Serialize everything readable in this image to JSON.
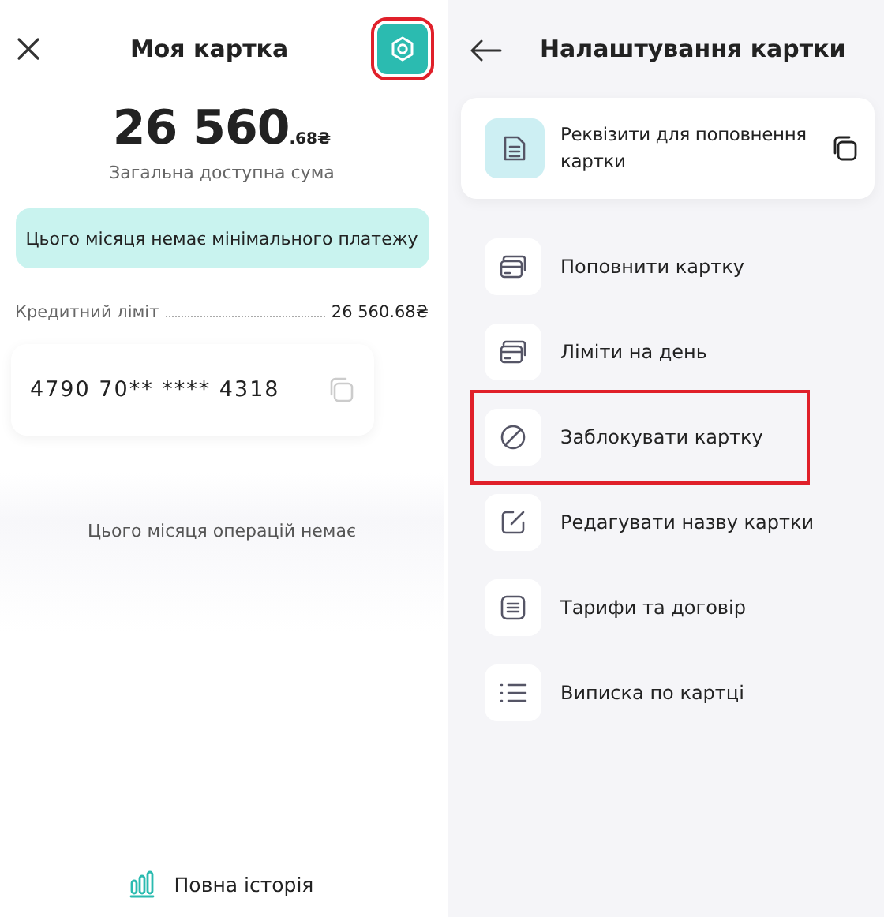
{
  "card_screen": {
    "title": "Моя картка",
    "settings_button": {
      "highlighted": true
    },
    "balance": {
      "whole": "26 560",
      "fraction": ".68₴"
    },
    "balance_caption": "Загальна доступна сума",
    "notice": "Цього місяця немає мінімального платежу",
    "credit_limit": {
      "label": "Кредитний ліміт",
      "value": "26 560.68₴"
    },
    "card_number": "4790 70** **** 4318",
    "empty_operations": "Цього місяця операцій немає",
    "history_link": "Повна історія"
  },
  "settings_screen": {
    "title": "Налаштування картки",
    "items": [
      {
        "kind": "requisites",
        "label": "Реквізити для поповнення картки"
      },
      {
        "kind": "card",
        "label": "Поповнити картку",
        "highlighted": false
      },
      {
        "kind": "card",
        "label": "Ліміти на день",
        "highlighted": false
      },
      {
        "kind": "block",
        "label": "Заблокувати картку",
        "highlighted": true
      },
      {
        "kind": "edit",
        "label": "Редагувати назву картки",
        "highlighted": false
      },
      {
        "kind": "document",
        "label": "Тарифи та договір",
        "highlighted": false
      },
      {
        "kind": "list",
        "label": "Виписка по картці",
        "highlighted": false
      }
    ]
  }
}
